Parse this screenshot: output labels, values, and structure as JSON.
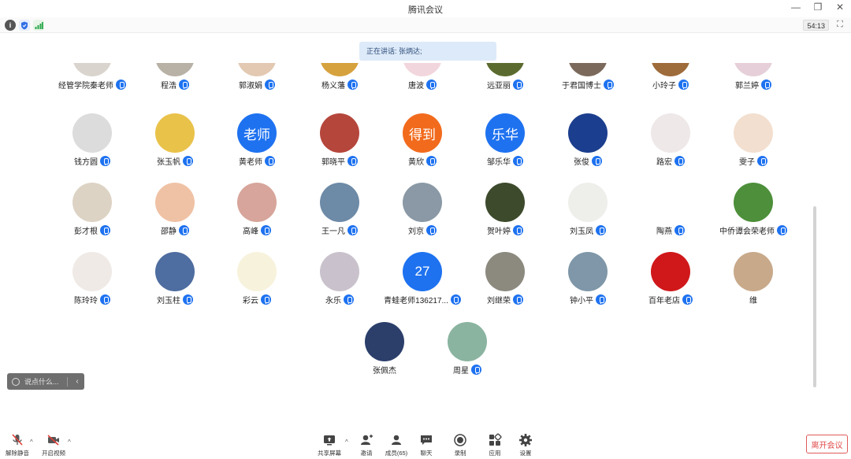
{
  "window": {
    "title": "腾讯会议",
    "minimize_icon": "minimize-icon",
    "restore_icon": "restore-icon",
    "close_icon": "close-icon"
  },
  "infobar": {
    "meeting_time": "54:13",
    "icons": [
      "info-icon",
      "shield-icon",
      "signal-icon",
      "fullscreen-icon"
    ]
  },
  "speaking_banner": "正在讲话: 张炳达;",
  "participants": [
    {
      "name": "经管学院秦老师",
      "avatar_color": "#d9d4cd",
      "mic": true
    },
    {
      "name": "程浩",
      "avatar_color": "#b8b1a6",
      "mic": true
    },
    {
      "name": "郭淑娟",
      "avatar_color": "#e3c9b2",
      "mic": true
    },
    {
      "name": "杨义藩",
      "avatar_color": "#d6a23e",
      "mic": true
    },
    {
      "name": "唐波",
      "avatar_color": "#f2d6dd",
      "mic": true
    },
    {
      "name": "远亚丽",
      "avatar_color": "#5b6b2f",
      "mic": true
    },
    {
      "name": "于君国博士",
      "avatar_color": "#7b6a5c",
      "mic": true
    },
    {
      "name": "小玲子",
      "avatar_color": "#9e6b3a",
      "mic": true
    },
    {
      "name": "郭兰婷",
      "avatar_color": "#e6cfd8",
      "mic": true
    },
    {
      "name": "钱方圆",
      "avatar_color": "#dcdcdc",
      "mic": true
    },
    {
      "name": "张玉帆",
      "avatar_color": "#e9c24a",
      "mic": true
    },
    {
      "name": "黄老师",
      "avatar_color": "#1e72f0",
      "avatar_text": "老师",
      "mic": true
    },
    {
      "name": "郭晓平",
      "avatar_color": "#b5463c",
      "mic": true
    },
    {
      "name": "黄欣",
      "avatar_color": "#f26b1d",
      "avatar_text": "得到",
      "mic": true
    },
    {
      "name": "邹乐华",
      "avatar_color": "#1e72f0",
      "avatar_text": "乐华",
      "mic": true
    },
    {
      "name": "张俊",
      "avatar_color": "#1c3e8e",
      "mic": true
    },
    {
      "name": "路宏",
      "avatar_color": "#efe8e8",
      "mic": true
    },
    {
      "name": "雯子",
      "avatar_color": "#f3dfcf",
      "mic": true
    },
    {
      "name": "彭才根",
      "avatar_color": "#ddd3c4",
      "mic": true
    },
    {
      "name": "邵静",
      "avatar_color": "#f0c2a5",
      "mic": true
    },
    {
      "name": "高峰",
      "avatar_color": "#d7a59b",
      "mic": true
    },
    {
      "name": "王一凡",
      "avatar_color": "#6d8aa7",
      "mic": true
    },
    {
      "name": "刘京",
      "avatar_color": "#8a99a5",
      "mic": true
    },
    {
      "name": "贺叶婷",
      "avatar_color": "#3d4a2c",
      "mic": true
    },
    {
      "name": "刘玉凤",
      "avatar_color": "#eeeeea",
      "mic": true
    },
    {
      "name": "陶燕",
      "avatar_color": "#ffffff",
      "mic": true
    },
    {
      "name": "中侨谭会荣老师",
      "avatar_color": "#4d8f3a",
      "mic": true
    },
    {
      "name": "陈玲玲",
      "avatar_color": "#efeae6",
      "mic": true
    },
    {
      "name": "刘玉柱",
      "avatar_color": "#4e6da0",
      "mic": true
    },
    {
      "name": "彩云",
      "avatar_color": "#f7f2dc",
      "mic": true
    },
    {
      "name": "永乐",
      "avatar_color": "#c9c2cc",
      "mic": true
    },
    {
      "name": "青蛙老师136217...",
      "avatar_color": "#1e72f0",
      "avatar_text": "27",
      "mic": true
    },
    {
      "name": "刘继荣",
      "avatar_color": "#8c8a7f",
      "mic": true
    },
    {
      "name": "钟小平",
      "avatar_color": "#7f97a8",
      "mic": true
    },
    {
      "name": "百年老店",
      "avatar_color": "#d0181b",
      "mic": true
    },
    {
      "name": "维",
      "avatar_color": "#c8a98a",
      "mic": false
    },
    {
      "name": "张佩杰",
      "avatar_color": "#2c3f6b",
      "mic": false
    },
    {
      "name": "周星",
      "avatar_color": "#8ab4a0",
      "mic": true
    }
  ],
  "chat_input": {
    "placeholder": "说点什么...",
    "icon": "smile-icon",
    "collapse_icon": "chevron-left-icon"
  },
  "toolbar": {
    "unmute": "解除静音",
    "start_video": "开启视频",
    "share_screen": "共享屏幕",
    "invite": "邀请",
    "members": "成员(65)",
    "chat": "聊天",
    "record": "录制",
    "apps": "应用",
    "settings": "设置",
    "leave": "离开会议"
  },
  "colors": {
    "accent": "#1e72f0",
    "leave": "#e04a4a",
    "mute_red": "#e0403a"
  }
}
